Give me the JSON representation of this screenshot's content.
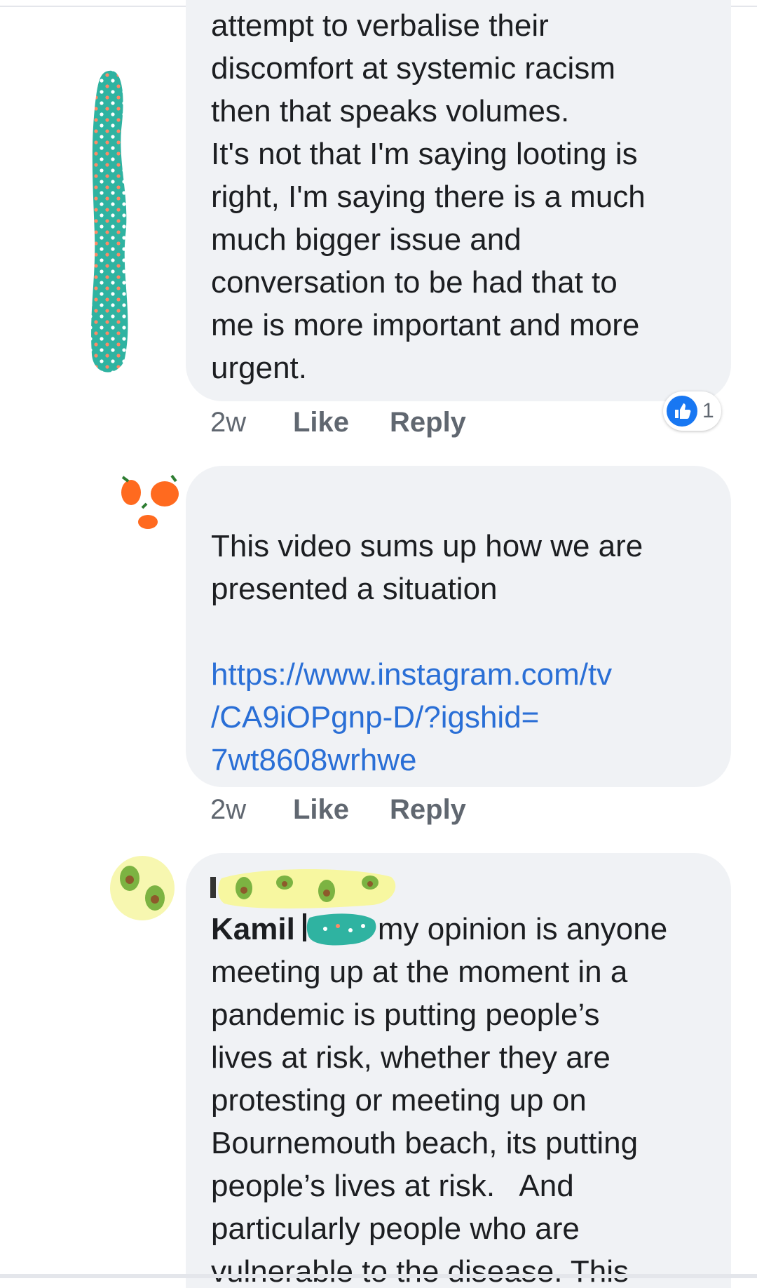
{
  "comments": [
    {
      "text": "attempt to verbalise their\ndiscomfort at systemic racism\nthen that speaks volumes.\nIt's not that I'm saying looting is\nright, I'm saying there is a much\nmuch bigger issue and\nconversation to be had that to\nme is more important and more\nurgent.",
      "time": "2w",
      "like_label": "Like",
      "reply_label": "Reply",
      "reaction_count": "1",
      "reaction_icon": "thumbs-up-icon",
      "reaction_color": "#1877f2"
    },
    {
      "text": "This video sums up how we are\npresented a situation",
      "link": "https://www.instagram.com/tv\n/CA9iOPgnp-D/?igshid=\n7wt8608wrhwe",
      "time": "2w",
      "like_label": "Like",
      "reply_label": "Reply"
    },
    {
      "mention": "Kamil",
      "text": "my opinion is anyone\nmeeting up at the moment in a\npandemic is putting people’s\nlives at risk, whether they are\nprotesting or meeting up on\nBournemouth beach, its putting\npeople’s lives at risk.   And\nparticularly people who are\nvulnerable to the disease. This"
    }
  ],
  "colors": {
    "bubble": "#f0f2f5",
    "link": "#2a6fd6",
    "meta": "#606770",
    "text": "#1c1e21"
  }
}
